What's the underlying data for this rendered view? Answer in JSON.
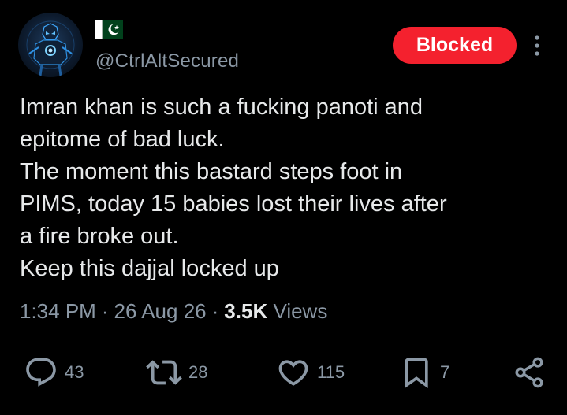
{
  "author": {
    "handle": "@CtrlAltSecured",
    "flag_icon": "pakistan-flag-icon",
    "avatar_icon": "armored-figure-avatar"
  },
  "follow_state": {
    "label": "Blocked",
    "color": "#f4212e"
  },
  "tweet": {
    "lines": [
      "Imran khan is such a fucking panoti and",
      "epitome of bad luck.",
      "The moment this bastard steps foot in",
      "PIMS, today 15 babies lost their lives after",
      "a fire broke out.",
      "Keep this dajjal locked up"
    ]
  },
  "meta": {
    "time": "1:34 PM",
    "separator": "·",
    "date": "26 Aug 26",
    "views_count": "3.5K",
    "views_label": "Views"
  },
  "actions": {
    "replies": {
      "icon": "reply-icon",
      "count": "43"
    },
    "reposts": {
      "icon": "repost-icon",
      "count": "28"
    },
    "likes": {
      "icon": "heart-icon",
      "count": "115"
    },
    "bookmarks": {
      "icon": "bookmark-icon",
      "count": "7"
    },
    "share": {
      "icon": "share-icon"
    }
  },
  "colors": {
    "background": "#000000",
    "text_primary": "#e7e9ea",
    "text_secondary": "#8b98a5",
    "blocked_red": "#f4212e"
  }
}
